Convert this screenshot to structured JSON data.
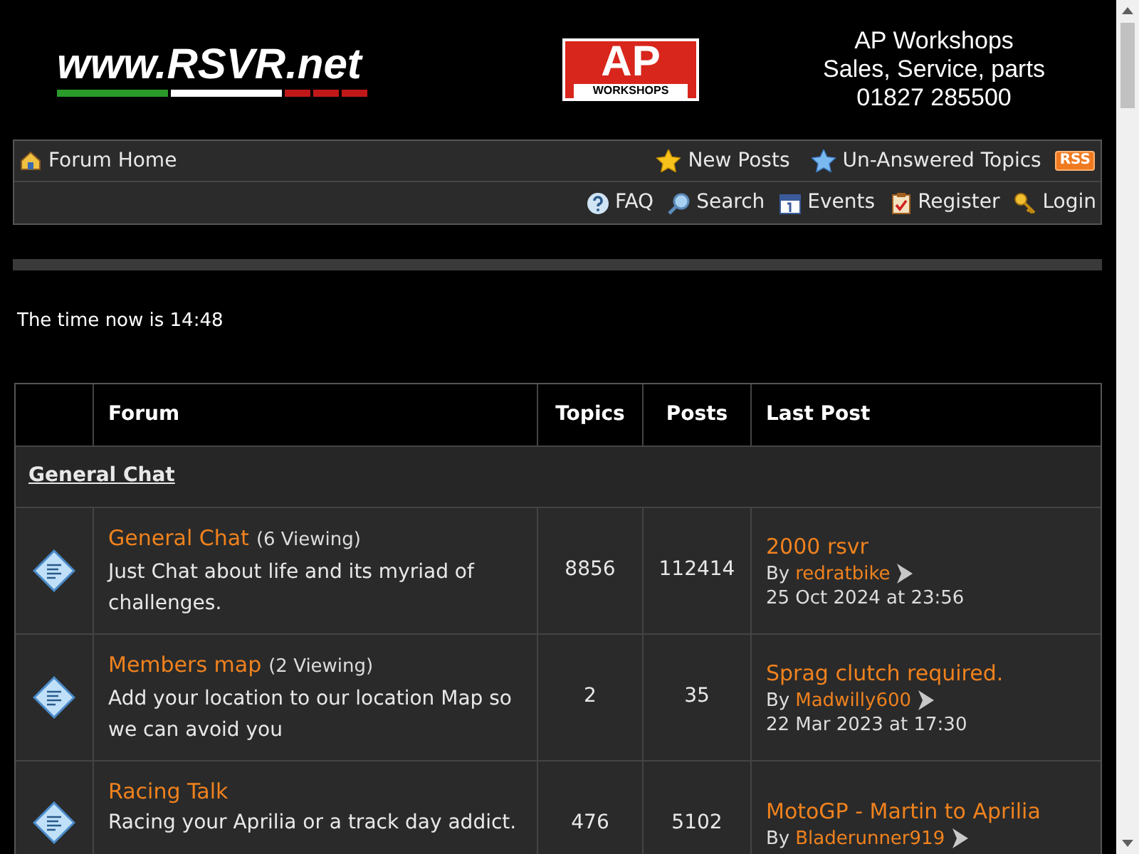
{
  "header": {
    "site_logo": "www.RSVR.net",
    "sponsor_logo": {
      "big": "AP",
      "small": "WORKSHOPS"
    },
    "sponsor_text": [
      "AP Workshops",
      "Sales, Service, parts",
      "01827 285500"
    ]
  },
  "nav": {
    "home": "Forum Home",
    "top_links": [
      {
        "label": "New Posts"
      },
      {
        "label": "Un-Answered Topics"
      }
    ],
    "rss": "RSS",
    "bottom_links": [
      {
        "label": "FAQ"
      },
      {
        "label": "Search"
      },
      {
        "label": "Events"
      },
      {
        "label": "Register"
      },
      {
        "label": "Login"
      }
    ]
  },
  "time_text": "The time now is 14:48",
  "table": {
    "columns": [
      "Forum",
      "Topics",
      "Posts",
      "Last Post"
    ],
    "category": "General Chat",
    "rows": [
      {
        "name": "General Chat",
        "viewing": "(6 Viewing)",
        "description": "Just Chat about life and its myriad of challenges.",
        "topics": "8856",
        "posts": "112414",
        "last_title": "2000 rsvr",
        "by": "By",
        "author": "redratbike",
        "date": "25 Oct 2024 at 23:56"
      },
      {
        "name": "Members map",
        "viewing": "(2 Viewing)",
        "description": "Add your location to our location Map so we can avoid you",
        "topics": "2",
        "posts": "35",
        "last_title": "Sprag clutch required.",
        "by": "By",
        "author": "Madwilly600",
        "date": "22 Mar 2023 at 17:30"
      },
      {
        "name": "Racing Talk",
        "description": "Racing your Aprilia or a track day addict.",
        "topics": "476",
        "posts": "5102",
        "last_title": "MotoGP - Martin to Aprilia",
        "by": "By",
        "author": "Bladerunner919"
      }
    ]
  }
}
